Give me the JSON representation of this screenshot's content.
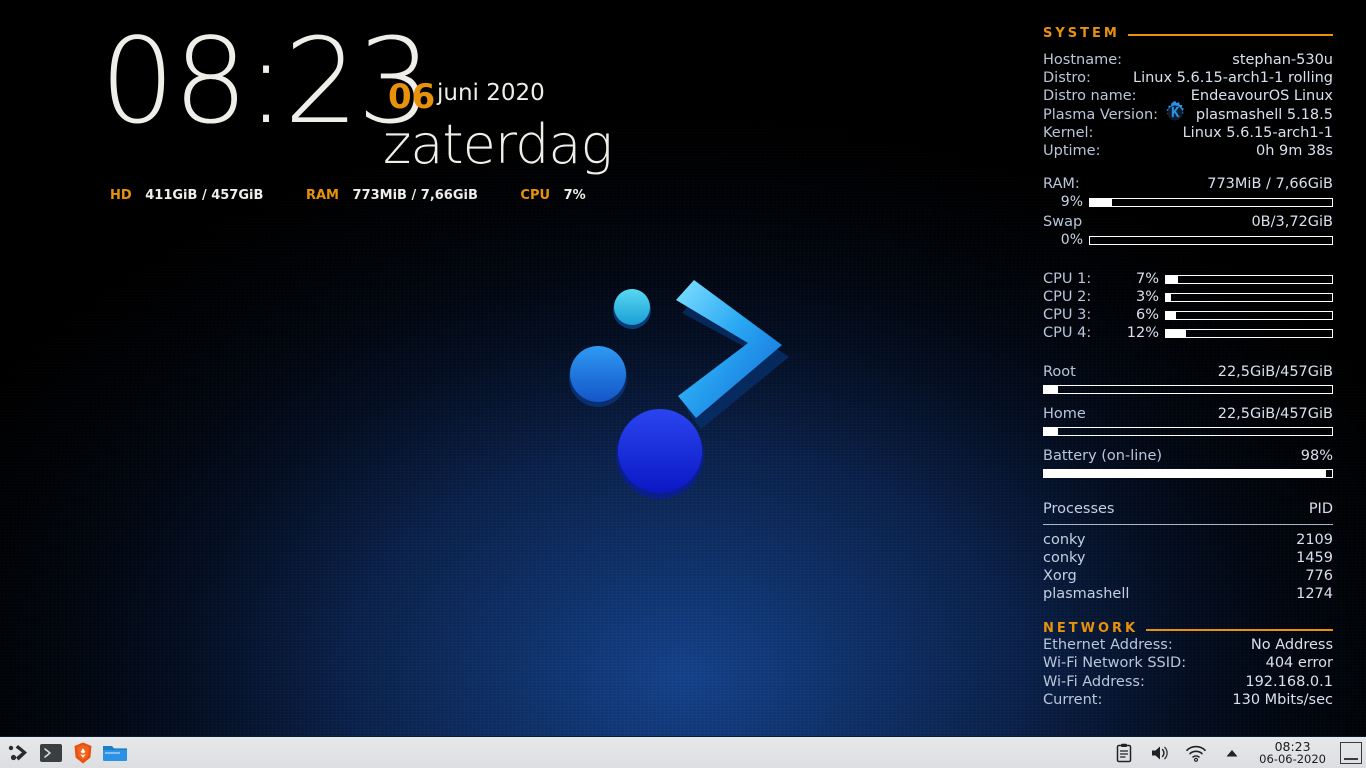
{
  "clock": {
    "time": "08:23",
    "day_number": "06",
    "month_year": "juni 2020",
    "weekday": "zaterdag",
    "mini_stats": [
      {
        "label": "HD",
        "value": "411GiB / 457GiB"
      },
      {
        "label": "RAM",
        "value": "773MiB / 7,66GiB"
      },
      {
        "label": "CPU",
        "value": "7%"
      }
    ]
  },
  "system": {
    "header": "SYSTEM",
    "info": [
      {
        "key": "Hostname:",
        "value": "stephan-530u"
      },
      {
        "key": "Distro:",
        "value": "Linux 5.6.15-arch1-1 rolling"
      },
      {
        "key": "Distro name:",
        "value": "EndeavourOS Linux"
      },
      {
        "key": "Plasma Version:",
        "value": "plasmashell 5.18.5"
      },
      {
        "key": "Kernel:",
        "value": "Linux 5.6.15-arch1-1"
      },
      {
        "key": "Uptime:",
        "value": "0h 9m 38s"
      }
    ],
    "memory": [
      {
        "key": "RAM:",
        "value": "773MiB / 7,66GiB",
        "percent_label": "9%",
        "percent": 9
      },
      {
        "key": "Swap",
        "value": "0B/3,72GiB",
        "percent_label": "0%",
        "percent": 0
      }
    ],
    "cpus": [
      {
        "key": "CPU 1:",
        "percent_label": "7%",
        "percent": 7
      },
      {
        "key": "CPU 2:",
        "percent_label": "3%",
        "percent": 3
      },
      {
        "key": "CPU 3:",
        "percent_label": "6%",
        "percent": 6
      },
      {
        "key": "CPU 4:",
        "percent_label": "12%",
        "percent": 12
      }
    ],
    "disks": [
      {
        "key": "Root",
        "value": "22,5GiB/457GiB",
        "percent": 5
      },
      {
        "key": "Home",
        "value": "22,5GiB/457GiB",
        "percent": 5
      }
    ],
    "battery": {
      "key": "Battery (on-line)",
      "value": "98%",
      "percent": 98
    },
    "processes": {
      "title": "Processes",
      "pid_header": "PID",
      "rows": [
        {
          "name": "conky",
          "pid": "2109"
        },
        {
          "name": "conky",
          "pid": "1459"
        },
        {
          "name": "Xorg",
          "pid": "776"
        },
        {
          "name": "plasmashell",
          "pid": "1274"
        }
      ]
    }
  },
  "network": {
    "header": "NETWORK",
    "rows": [
      {
        "key": "Ethernet Address:",
        "value": "No Address"
      },
      {
        "key": "Wi-Fi Network SSID:",
        "value": "404 error"
      },
      {
        "key": "Wi-Fi Address:",
        "value": "192.168.0.1"
      },
      {
        "key": "Current:",
        "value": "130  Mbits/sec"
      }
    ]
  },
  "taskbar": {
    "launchers": [
      {
        "name": "endeavouros-menu-icon",
        "title": "EndeavourOS Menu"
      },
      {
        "name": "terminal-icon",
        "title": "Terminal"
      },
      {
        "name": "brave-browser-icon",
        "title": "Brave Browser"
      },
      {
        "name": "file-manager-icon",
        "title": "File Manager"
      }
    ],
    "tray": [
      {
        "name": "clipboard-icon",
        "title": "Clipboard"
      },
      {
        "name": "volume-icon",
        "title": "Volume"
      },
      {
        "name": "wifi-icon",
        "title": "Wi-Fi"
      },
      {
        "name": "chevron-up-icon",
        "title": "Show hidden icons"
      }
    ],
    "clock_time": "08:23",
    "clock_date": "06-06-2020",
    "show_desktop_title": "Show Desktop"
  },
  "colors": {
    "accent_orange": "#e8920c",
    "text_light": "#f0eee8",
    "conky_text": "#c7d3e4",
    "bar_white": "#ffffff",
    "wallpaper_blue": "#14428c",
    "taskbar_bg": "#e0e2e4"
  }
}
